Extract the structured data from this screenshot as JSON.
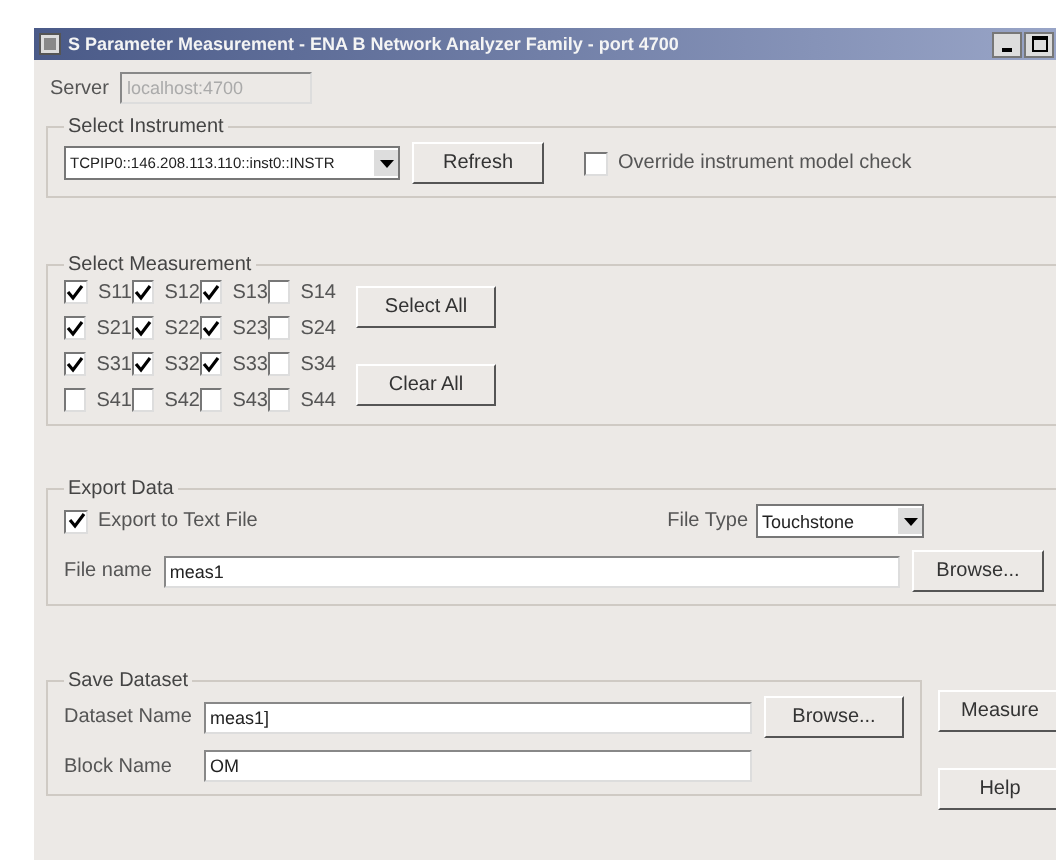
{
  "window": {
    "title": "S Parameter Measurement - ENA B Network Analyzer Family - port 4700"
  },
  "server": {
    "label": "Server",
    "value": "localhost:4700",
    "disabled": true
  },
  "select_instrument": {
    "title": "Select Instrument",
    "instrument": "TCPIP0::146.208.113.110::inst0::INSTR",
    "refresh": "Refresh",
    "override": {
      "label": "Override instrument model check",
      "checked": false
    }
  },
  "select_measurement": {
    "title": "Select Measurement",
    "params": [
      [
        {
          "label": "S11",
          "checked": true
        },
        {
          "label": "S12",
          "checked": true
        },
        {
          "label": "S13",
          "checked": true
        },
        {
          "label": "S14",
          "checked": false
        }
      ],
      [
        {
          "label": "S21",
          "checked": true
        },
        {
          "label": "S22",
          "checked": true
        },
        {
          "label": "S23",
          "checked": true
        },
        {
          "label": "S24",
          "checked": false
        }
      ],
      [
        {
          "label": "S31",
          "checked": true
        },
        {
          "label": "S32",
          "checked": true
        },
        {
          "label": "S33",
          "checked": true
        },
        {
          "label": "S34",
          "checked": false
        }
      ],
      [
        {
          "label": "S41",
          "checked": false
        },
        {
          "label": "S42",
          "checked": false
        },
        {
          "label": "S43",
          "checked": false
        },
        {
          "label": "S44",
          "checked": false
        }
      ]
    ],
    "select_all": "Select All",
    "clear_all": "Clear All"
  },
  "export_data": {
    "title": "Export Data",
    "export": {
      "label": "Export to Text File",
      "checked": true
    },
    "file_type_label": "File Type",
    "file_type": "Touchstone",
    "file_name_label": "File name",
    "file_name": "meas1",
    "browse": "Browse..."
  },
  "save_dataset": {
    "title": "Save Dataset",
    "dataset_label": "Dataset Name",
    "dataset": "meas1]",
    "block_label": "Block Name",
    "block": "OM",
    "browse": "Browse..."
  },
  "buttons": [
    "Measure",
    "Help"
  ]
}
